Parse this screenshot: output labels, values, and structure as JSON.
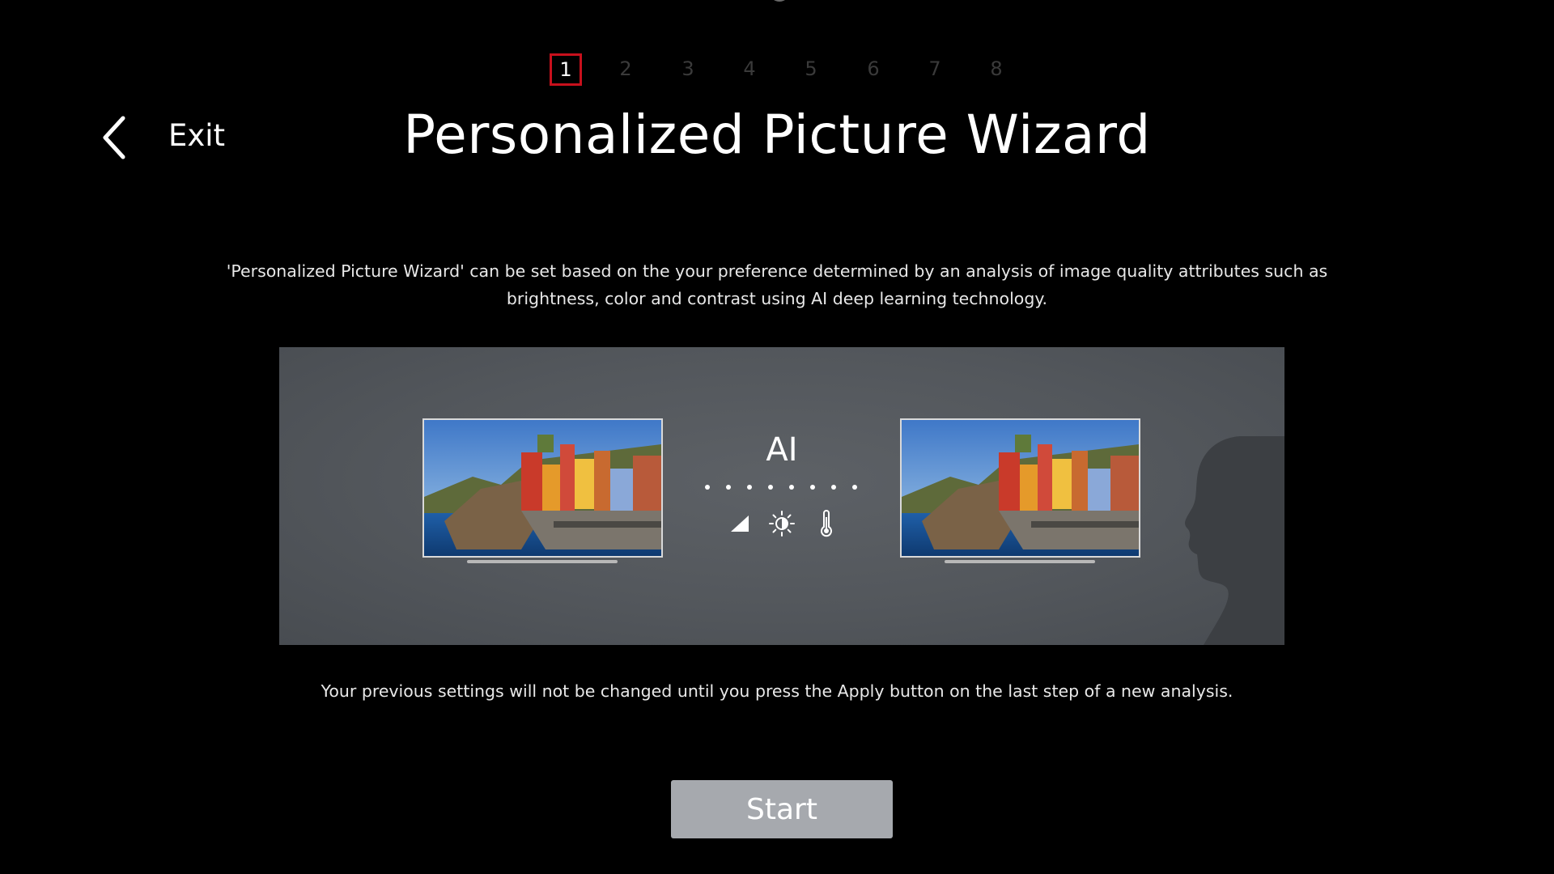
{
  "wizard": {
    "steps": [
      "1",
      "2",
      "3",
      "4",
      "5",
      "6",
      "7",
      "8"
    ],
    "current_step": 1,
    "exit_label": "Exit",
    "title": "Personalized Picture Wizard",
    "description": "'Personalized Picture Wizard' can be set based on the your preference determined by an analysis of image quality attributes such as brightness, color and contrast using AI deep learning technology.",
    "illustration": {
      "ai_label": "AI",
      "attribute_icons": [
        "contrast-icon",
        "brightness-icon",
        "color-temperature-icon"
      ]
    },
    "note": "Your previous settings will not be changed until you press the Apply button on the last step of a new analysis.",
    "start_label": "Start"
  },
  "colors": {
    "background": "#000000",
    "active_step_border": "#c8101c",
    "inactive_step": "#3a3a3a",
    "panel": "#55595e",
    "start_button": "#a6a9ae"
  }
}
